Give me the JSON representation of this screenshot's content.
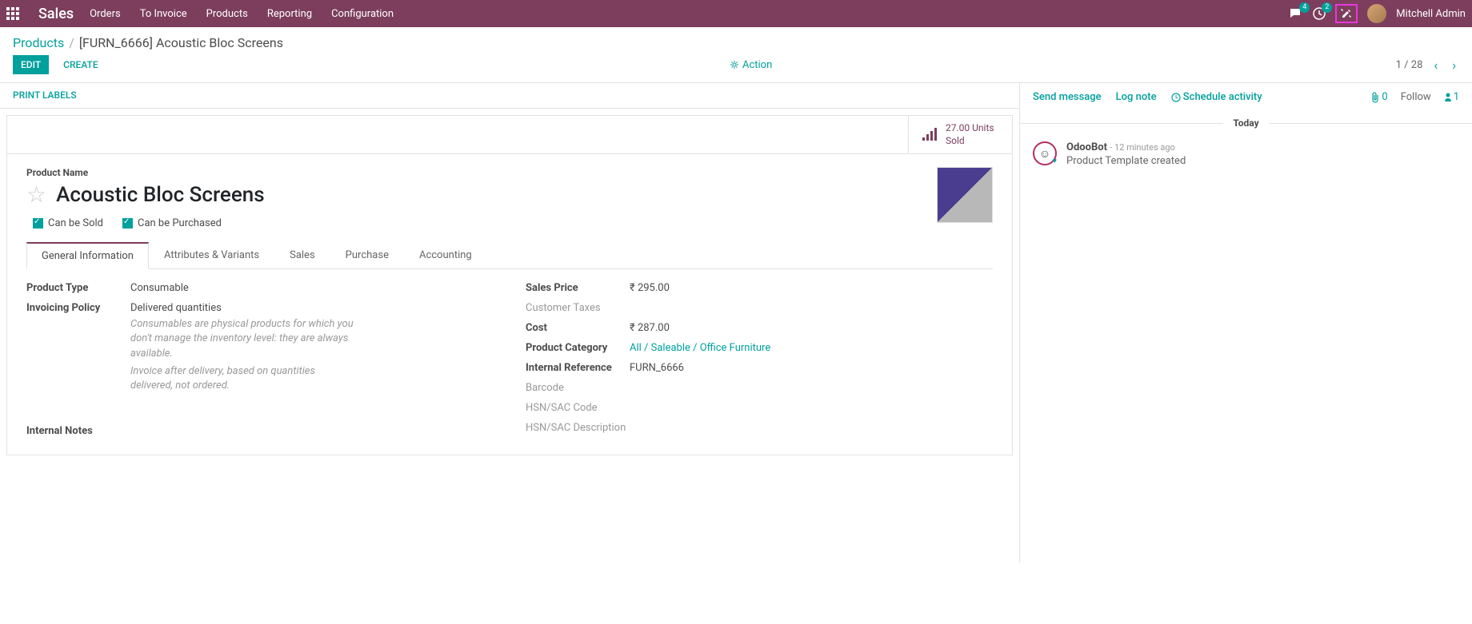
{
  "navbar": {
    "brand": "Sales",
    "links": [
      "Orders",
      "To Invoice",
      "Products",
      "Reporting",
      "Configuration"
    ],
    "msg_badge": "4",
    "activity_badge": "2",
    "user_name": "Mitchell Admin"
  },
  "breadcrumb": {
    "root": "Products",
    "current": "[FURN_6666] Acoustic Bloc Screens"
  },
  "cp": {
    "edit": "EDIT",
    "create": "CREATE",
    "action": "Action",
    "pager": "1 / 28"
  },
  "print_labels": "PRINT LABELS",
  "stat": {
    "line1": "27.00 Units",
    "line2": "Sold"
  },
  "product": {
    "name_label": "Product Name",
    "name": "Acoustic Bloc Screens",
    "can_be_sold": "Can be Sold",
    "can_be_purchased": "Can be Purchased"
  },
  "tabs": [
    "General Information",
    "Attributes & Variants",
    "Sales",
    "Purchase",
    "Accounting"
  ],
  "left_fields": {
    "product_type_label": "Product Type",
    "product_type_value": "Consumable",
    "invoicing_policy_label": "Invoicing Policy",
    "invoicing_policy_value": "Delivered quantities",
    "help1": "Consumables are physical products for which you don't manage the inventory level: they are always available.",
    "help2": "Invoice after delivery, based on quantities delivered, not ordered."
  },
  "right_fields": {
    "sales_price_label": "Sales Price",
    "sales_price_value": "₹ 295.00",
    "customer_taxes_label": "Customer Taxes",
    "cost_label": "Cost",
    "cost_value": "₹ 287.00",
    "product_category_label": "Product Category",
    "product_category_value": "All / Saleable / Office Furniture",
    "internal_ref_label": "Internal Reference",
    "internal_ref_value": "FURN_6666",
    "barcode_label": "Barcode",
    "hsn_code_label": "HSN/SAC Code",
    "hsn_desc_label": "HSN/SAC Description"
  },
  "internal_notes_label": "Internal Notes",
  "chatter": {
    "send_message": "Send message",
    "log_note": "Log note",
    "schedule_activity": "Schedule activity",
    "attach_count": "0",
    "follow": "Follow",
    "follower_count": "1",
    "today": "Today",
    "msg_author": "OdooBot",
    "msg_time": "- 12 minutes ago",
    "msg_text": "Product Template created"
  }
}
